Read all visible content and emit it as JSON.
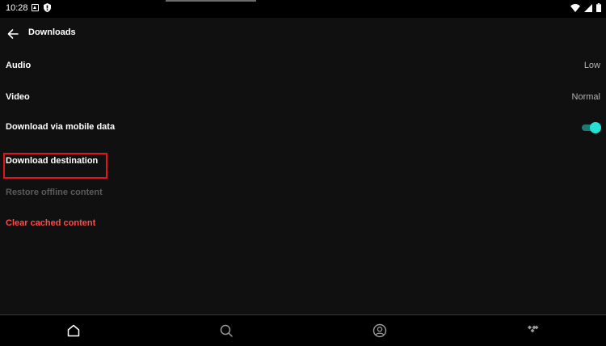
{
  "status_bar": {
    "time": "10:28",
    "left_icons": [
      "app-a-icon",
      "shield-icon"
    ],
    "right_icons": [
      "wifi-icon",
      "cellular-icon",
      "battery-icon"
    ]
  },
  "header": {
    "title": "Downloads",
    "back_icon": "arrow-left-icon"
  },
  "settings": {
    "audio": {
      "label": "Audio",
      "value": "Low"
    },
    "video": {
      "label": "Video",
      "value": "Normal"
    },
    "mobile_data": {
      "label": "Download via mobile data",
      "enabled": true
    },
    "destination": {
      "label": "Download destination"
    },
    "restore": {
      "label": "Restore offline content",
      "disabled": true
    },
    "clear_cache": {
      "label": "Clear cached content"
    }
  },
  "bottom_nav": {
    "items": [
      {
        "icon": "home-icon",
        "active": true
      },
      {
        "icon": "search-icon",
        "active": false
      },
      {
        "icon": "profile-icon",
        "active": false
      },
      {
        "icon": "tidal-logo-icon",
        "active": false
      }
    ]
  },
  "colors": {
    "background": "#101010",
    "accent": "#26e1d3",
    "danger": "#ff4a4a",
    "highlight": "#e0141e"
  }
}
